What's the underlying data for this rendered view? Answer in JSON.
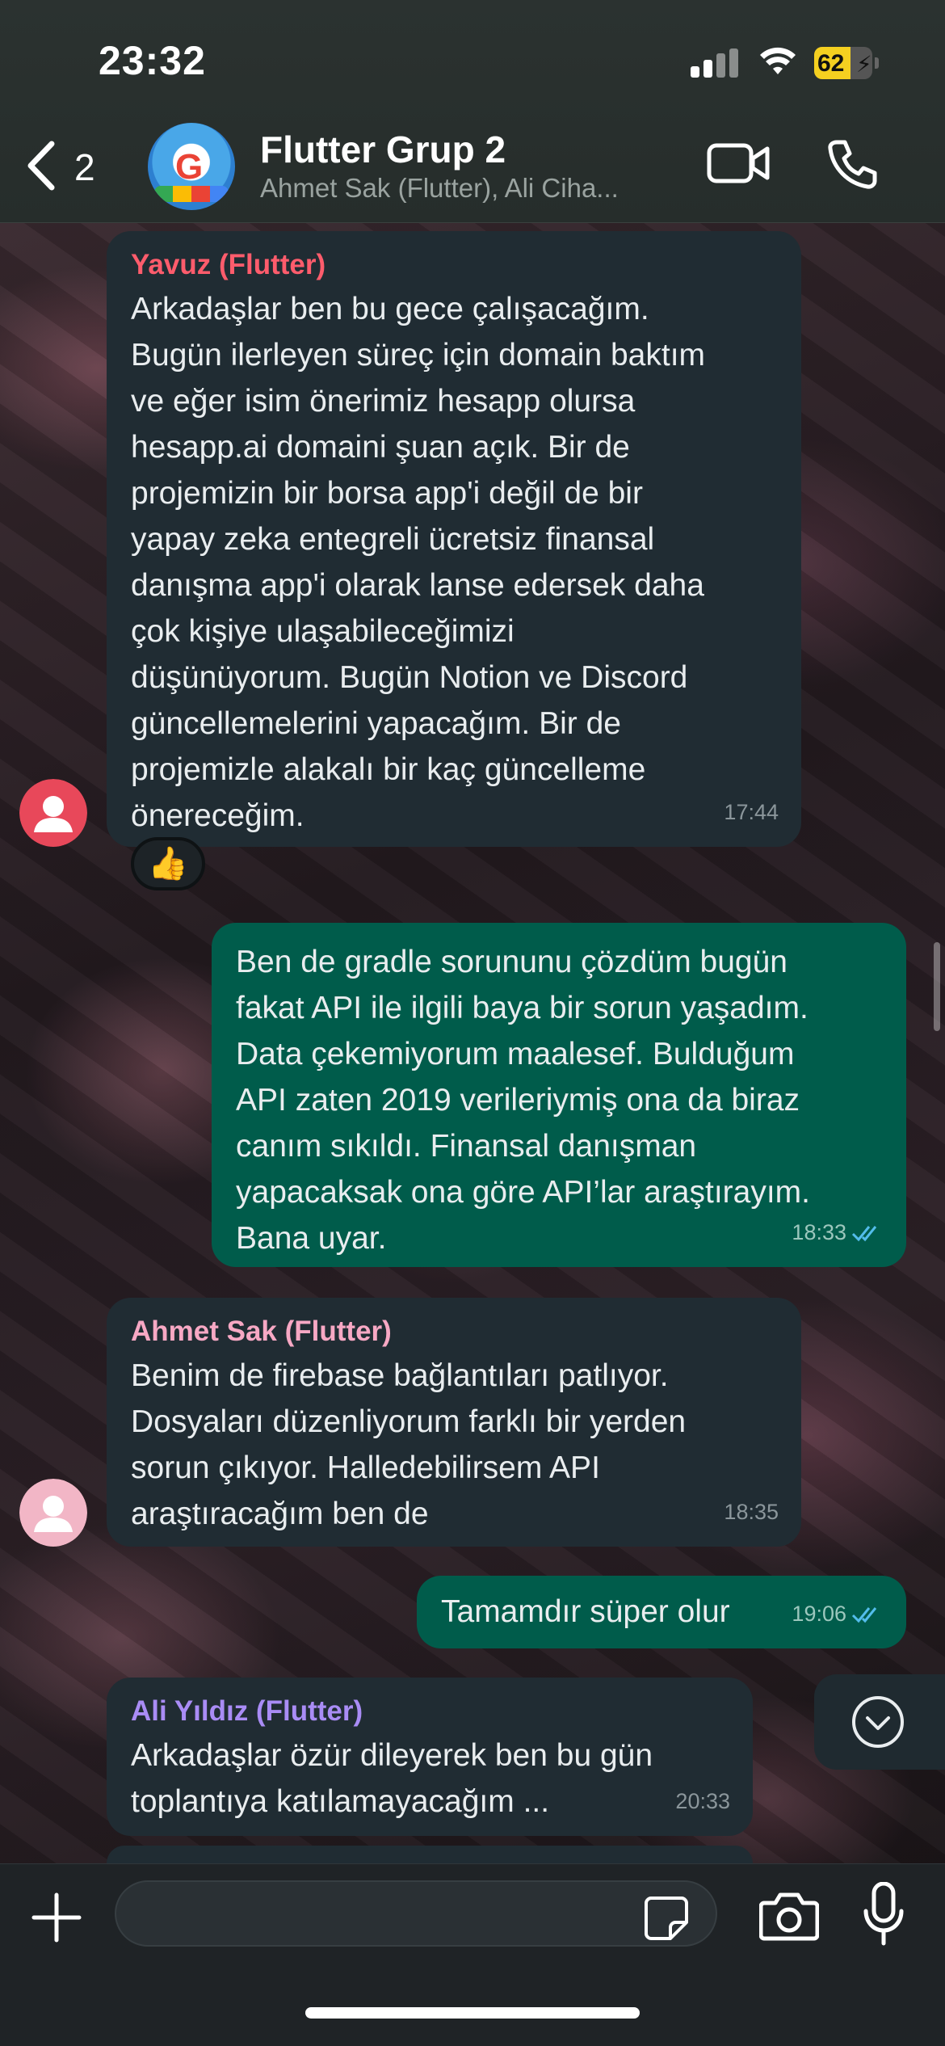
{
  "status_bar": {
    "time": "23:32",
    "battery_percent": "62",
    "battery_level": 0.62
  },
  "header": {
    "back_count": "2",
    "title": "Flutter Grup 2",
    "subtitle": "Ahmet Sak (Flutter), Ali Ciha..."
  },
  "messages": [
    {
      "direction": "in",
      "sender": "Yavuz (Flutter)",
      "sender_color": "#ff5c6c",
      "text": "Arkadaşlar ben bu gece çalışacağım.\nBugün ilerleyen süreç için domain baktım\nve eğer isim önerimiz hesapp olursa\nhesapp.ai domaini şuan açık. Bir de\nprojemizin bir borsa app'i değil de bir\nyapay zeka entegreli ücretsiz finansal\ndanışma app'i olarak lanse edersek daha\nçok kişiye ulaşabileceğimizi\ndüşünüyorum. Bugün Notion ve Discord\ngüncellemelerini yapacağım. Bir de\nprojemizle alakalı bir kaç güncelleme\nönereceğim.",
      "time": "17:44",
      "reaction": "👍",
      "avatar_color": "#e8485a"
    },
    {
      "direction": "out",
      "text": "Ben de gradle sorununu çözdüm bugün\nfakat API ile ilgili baya bir sorun yaşadım.\nData çekemiyorum maalesef. Bulduğum\nAPI zaten 2019 verileriymiş ona da biraz\ncanım sıkıldı. Finansal danışman\nyapacaksak ona göre API’lar araştırayım.\nBana uyar.",
      "time": "18:33",
      "read": true
    },
    {
      "direction": "in",
      "sender": "Ahmet Sak (Flutter)",
      "sender_color": "#f7a8c4",
      "text": "Benim de firebase bağlantıları patlıyor.\nDosyaları düzenliyorum farklı bir yerden\nsorun çıkıyor. Halledebilirsem API\naraştıracağım ben de",
      "time": "18:35",
      "avatar_color": "#f2b6c6"
    },
    {
      "direction": "out",
      "text": "Tamamdır süper olur",
      "time": "19:06",
      "read": true
    },
    {
      "direction": "in",
      "sender": "Ali Yıldız (Flutter)",
      "sender_color": "#a98cf5",
      "text": "Arkadaşlar özür dileyerek ben bu gün\ntoplantıya katılamayacağım ...",
      "time": "20:33"
    }
  ],
  "composer": {
    "placeholder": ""
  },
  "icons": {
    "back": "chevron-left-icon",
    "video": "video-camera-icon",
    "call": "phone-icon",
    "scroll_down": "chevron-down-circle-icon",
    "plus": "plus-icon",
    "sticker": "sticker-icon",
    "camera": "camera-icon",
    "mic": "microphone-icon"
  },
  "colors": {
    "incoming_bubble": "#202c33",
    "outgoing_bubble": "#005c4b",
    "read_ticks": "#53bdeb",
    "battery_fill": "#f5d020"
  }
}
